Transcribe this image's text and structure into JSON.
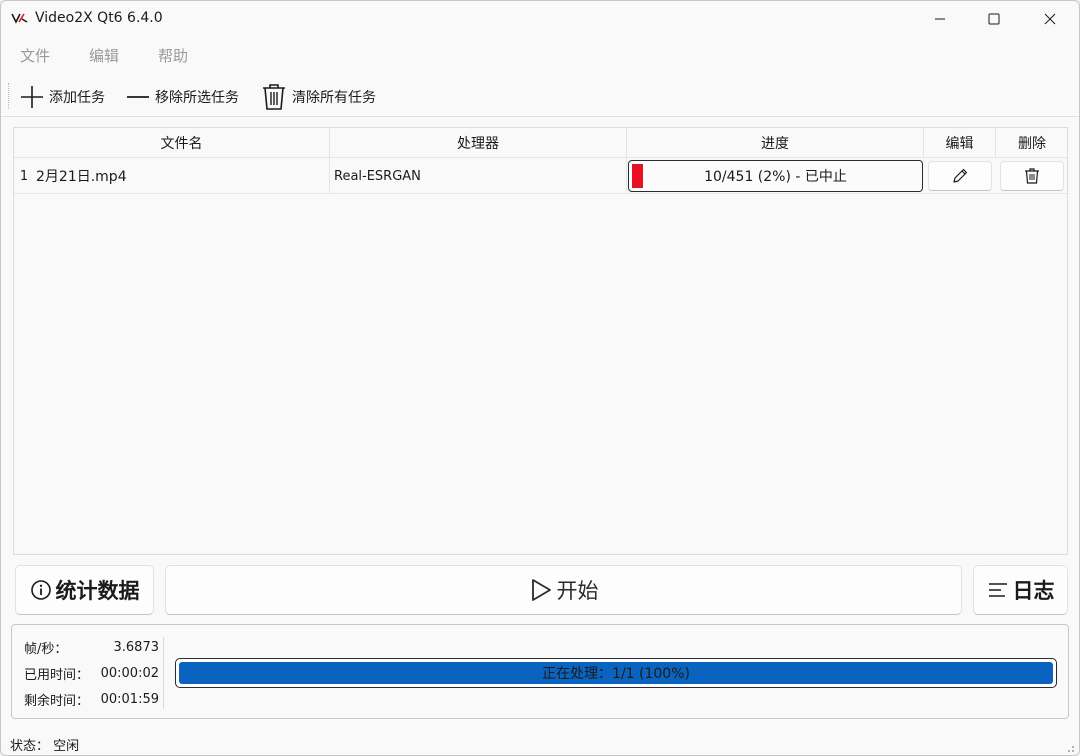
{
  "window": {
    "title": "Video2X Qt6 6.4.0"
  },
  "menu": {
    "file": "文件",
    "edit": "编辑",
    "help": "帮助"
  },
  "toolbar": {
    "add_task": "添加任务",
    "remove_selected": "移除所选任务",
    "clear_all": "清除所有任务"
  },
  "table": {
    "columns": {
      "filename": "文件名",
      "processor": "处理器",
      "progress": "进度",
      "edit": "编辑",
      "delete": "删除"
    },
    "rows": [
      {
        "index": "1",
        "filename": "2月21日.mp4",
        "processor": "Real-ESRGAN",
        "progress_text": "10/451 (2%) - 已中止",
        "progress_fraction": 0.02
      }
    ]
  },
  "actions": {
    "stats": "统计数据",
    "start": "开始",
    "log": "日志"
  },
  "stats": {
    "fps_label": "帧/秒：",
    "fps_value": "3.6873",
    "elapsed_label": "已用时间：",
    "elapsed_value": "00:00:02",
    "remaining_label": "剩余时间：",
    "remaining_value": "00:01:59"
  },
  "overall": {
    "text": "正在处理：1/1 (100%)",
    "fraction": 1.0
  },
  "statusbar": {
    "text": "状态：  空闲"
  },
  "colors": {
    "accent": "#0a64bf",
    "error": "#e81123"
  }
}
